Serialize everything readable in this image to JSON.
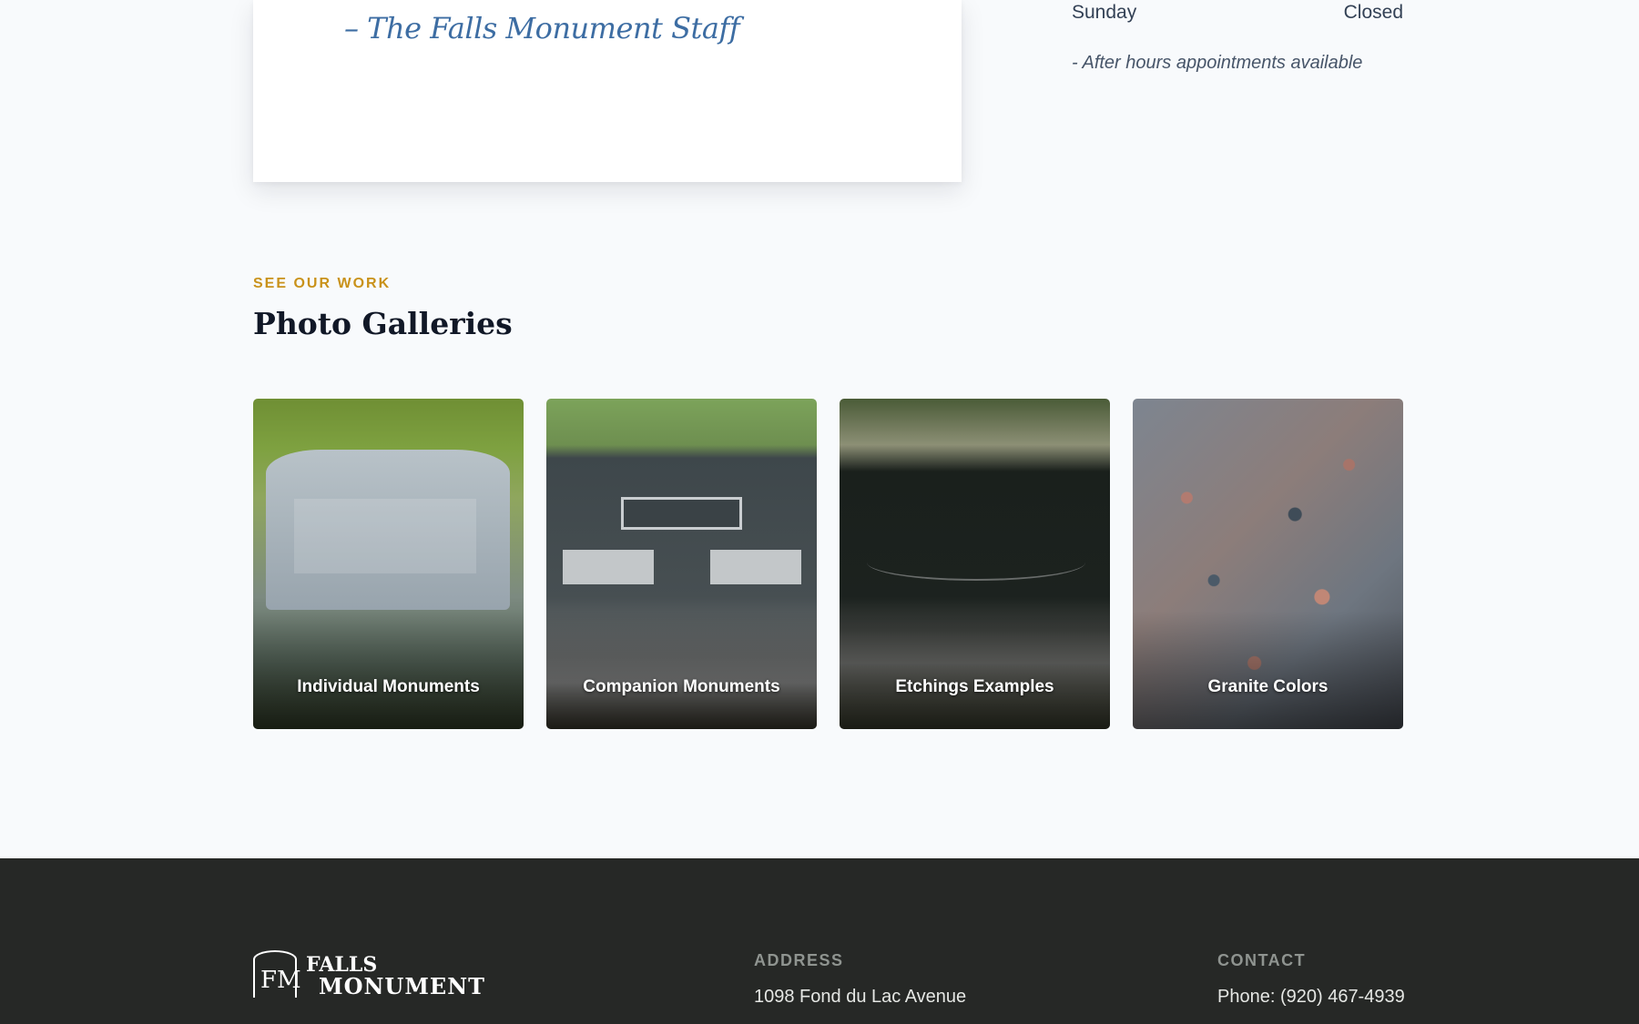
{
  "letter": {
    "signature": "– The Falls Monument Staff"
  },
  "hours": {
    "rows": [
      {
        "day": "Sunday",
        "time": "Closed"
      }
    ],
    "note": "- After hours appointments available"
  },
  "gallery": {
    "eyebrow": "SEE OUR WORK",
    "title": "Photo Galleries",
    "tiles": [
      {
        "label": "Individual Monuments"
      },
      {
        "label": "Companion Monuments"
      },
      {
        "label": "Etchings Examples"
      },
      {
        "label": "Granite Colors"
      }
    ]
  },
  "footer": {
    "logo": {
      "line1": "FALLS",
      "line2": "MONUMENT",
      "mark": "FM"
    },
    "address": {
      "heading": "ADDRESS",
      "line1": "1098 Fond du Lac Avenue"
    },
    "contact": {
      "heading": "CONTACT",
      "phone": "Phone: (920) 467-4939"
    }
  }
}
